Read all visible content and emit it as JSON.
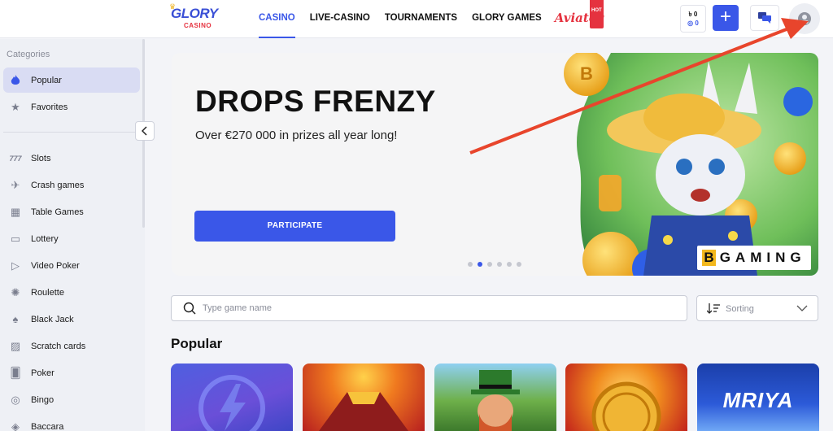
{
  "header": {
    "logo_text": "GLORY",
    "logo_sub": "CASINO",
    "nav": [
      {
        "label": "CASINO",
        "active": true
      },
      {
        "label": "LIVE-CASINO",
        "active": false
      },
      {
        "label": "TOURNAMENTS",
        "active": false
      },
      {
        "label": "GLORY GAMES",
        "active": false
      }
    ],
    "aviator_label": "Aviator",
    "aviator_badge": "HOT",
    "balance_main": "৳ 0",
    "balance_bonus": "◎ 0",
    "plus_icon": "plus-icon",
    "chat_icon": "chat-icon",
    "avatar_icon": "user-icon"
  },
  "sidebar": {
    "title": "Categories",
    "items": [
      {
        "label": "Popular",
        "icon": "fire-icon",
        "active": true
      },
      {
        "label": "Favorites",
        "icon": "star-icon"
      },
      {
        "label": "Slots",
        "icon": "slots-777-icon"
      },
      {
        "label": "Crash games",
        "icon": "plane-icon"
      },
      {
        "label": "Table Games",
        "icon": "table-games-icon"
      },
      {
        "label": "Lottery",
        "icon": "ticket-icon"
      },
      {
        "label": "Video Poker",
        "icon": "play-icon"
      },
      {
        "label": "Roulette",
        "icon": "roulette-icon"
      },
      {
        "label": "Black Jack",
        "icon": "spade-icon"
      },
      {
        "label": "Scratch cards",
        "icon": "scratch-card-icon"
      },
      {
        "label": "Poker",
        "icon": "cards-icon"
      },
      {
        "label": "Bingo",
        "icon": "bingo-ball-icon"
      },
      {
        "label": "Baccara",
        "icon": "baccara-icon"
      }
    ]
  },
  "banner": {
    "title": "DROPS FRENZY",
    "subtitle": "Over €270 000 in prizes all year long!",
    "button": "PARTICIPATE",
    "provider_b": "B",
    "provider_rest": "GAMING",
    "slides": 6,
    "active_slide": 2
  },
  "search": {
    "placeholder": "Type game name",
    "value": ""
  },
  "sorting": {
    "label": "Sorting"
  },
  "section": {
    "title": "Popular"
  },
  "games": [
    {
      "name": "lightning-game"
    },
    {
      "name": "volcano-game"
    },
    {
      "name": "leprechaun-game"
    },
    {
      "name": "coin-game"
    },
    {
      "name": "mriya-game",
      "text": "MRIYA"
    }
  ],
  "colors": {
    "accent": "#3a57e8",
    "annotation_arrow": "#e8452c"
  }
}
